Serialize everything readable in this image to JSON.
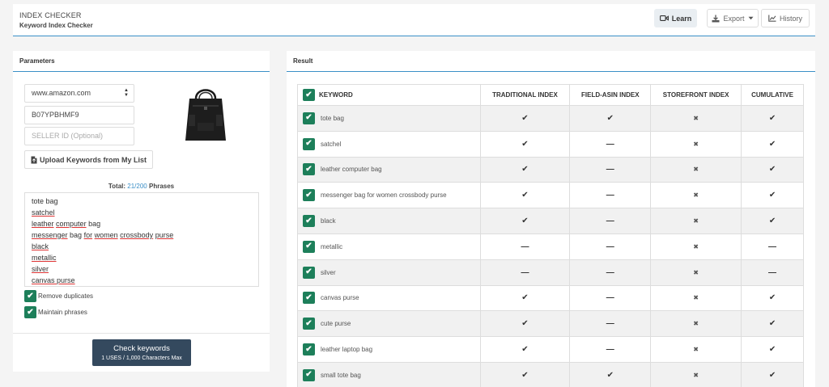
{
  "header": {
    "title": "INDEX CHECKER",
    "subtitle": "Keyword Index Checker",
    "learn_label": "Learn",
    "export_label": "Export",
    "history_label": "History"
  },
  "parameters": {
    "title": "Parameters",
    "marketplace": "www.amazon.com",
    "asin": "B07YPBHMF9",
    "seller_placeholder": "SELLER ID (Optional)",
    "upload_label": "Upload Keywords from My List",
    "total_label": "Total:",
    "total_count": "21",
    "total_sep": "/",
    "total_max": "200",
    "total_suffix": "Phrases",
    "keywords_text": [
      "tote bag",
      "satchel",
      "leather computer bag",
      "messenger bag for women crossbody purse",
      "black",
      "metallic",
      "silver",
      "canvas purse"
    ],
    "remove_duplicates_label": "Remove duplicates",
    "maintain_phrases_label": "Maintain phrases",
    "check_button_label": "Check keywords",
    "check_button_sub": "1 USES / 1,000 Characters Max"
  },
  "result": {
    "title": "Result",
    "columns": [
      "KEYWORD",
      "TRADITIONAL INDEX",
      "FIELD-ASIN INDEX",
      "STOREFRONT INDEX",
      "CUMULATIVE"
    ],
    "rows": [
      {
        "keyword": "tote bag",
        "traditional": "✔",
        "field_asin": "✔",
        "storefront": "✖",
        "cumulative": "✔"
      },
      {
        "keyword": "satchel",
        "traditional": "✔",
        "field_asin": "—",
        "storefront": "✖",
        "cumulative": "✔"
      },
      {
        "keyword": "leather computer bag",
        "traditional": "✔",
        "field_asin": "—",
        "storefront": "✖",
        "cumulative": "✔"
      },
      {
        "keyword": "messenger bag for women crossbody purse",
        "traditional": "✔",
        "field_asin": "—",
        "storefront": "✖",
        "cumulative": "✔"
      },
      {
        "keyword": "black",
        "traditional": "✔",
        "field_asin": "—",
        "storefront": "✖",
        "cumulative": "✔"
      },
      {
        "keyword": "metallic",
        "traditional": "—",
        "field_asin": "—",
        "storefront": "✖",
        "cumulative": "—"
      },
      {
        "keyword": "silver",
        "traditional": "—",
        "field_asin": "—",
        "storefront": "✖",
        "cumulative": "—"
      },
      {
        "keyword": "canvas purse",
        "traditional": "✔",
        "field_asin": "—",
        "storefront": "✖",
        "cumulative": "✔"
      },
      {
        "keyword": "cute purse",
        "traditional": "✔",
        "field_asin": "—",
        "storefront": "✖",
        "cumulative": "✔"
      },
      {
        "keyword": "leather laptop bag",
        "traditional": "✔",
        "field_asin": "—",
        "storefront": "✖",
        "cumulative": "✔"
      },
      {
        "keyword": "small tote bag",
        "traditional": "✔",
        "field_asin": "✔",
        "storefront": "✖",
        "cumulative": "✔"
      }
    ]
  },
  "icons": {
    "check": "✔",
    "learn": "video-camera-icon",
    "export": "download-icon",
    "history": "line-chart-icon",
    "upload": "file-icon"
  },
  "colors": {
    "accent": "#3b8fc7",
    "checkbox": "#1d7f5a",
    "button": "#34495e"
  }
}
